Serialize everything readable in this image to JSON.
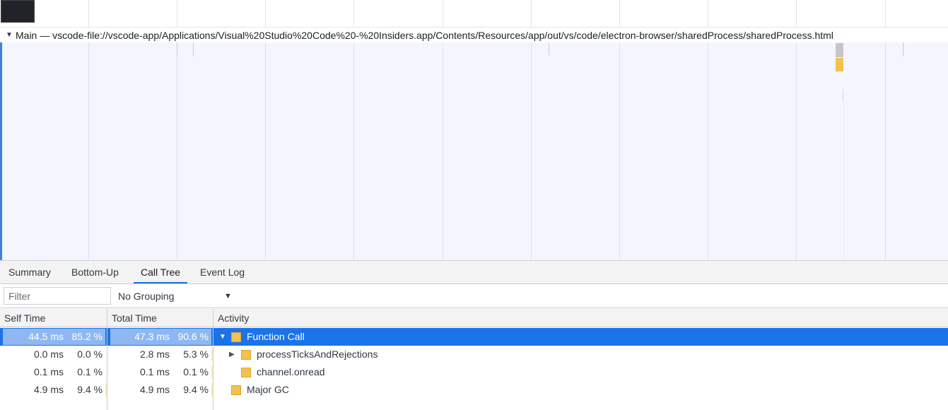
{
  "track": {
    "arrow": "▼",
    "title": "Main — vscode-file://vscode-app/Applications/Visual%20Studio%20Code%20-%20Insiders.app/Contents/Resources/app/out/vs/code/electron-browser/sharedProcess/sharedProcess.html"
  },
  "tabs": [
    {
      "label": "Summary",
      "active": false
    },
    {
      "label": "Bottom-Up",
      "active": false
    },
    {
      "label": "Call Tree",
      "active": true
    },
    {
      "label": "Event Log",
      "active": false
    }
  ],
  "toolbar": {
    "filter_placeholder": "Filter",
    "filter_value": "",
    "grouping": "No Grouping",
    "grouping_arrow": "▼"
  },
  "columns": {
    "self_time": "Self Time",
    "total_time": "Total Time",
    "activity": "Activity"
  },
  "rows": [
    {
      "self_ms": "44.5 ms",
      "self_pct": "85.2 %",
      "self_frac": 0.852,
      "total_ms": "47.3 ms",
      "total_pct": "90.6 %",
      "total_frac": 0.906,
      "disclose": "▼",
      "activity": "Function Call",
      "selected": true
    },
    {
      "self_ms": "0.0 ms",
      "self_pct": "0.0 %",
      "self_frac": 0.0,
      "total_ms": "2.8 ms",
      "total_pct": "5.3 %",
      "total_frac": 0.053,
      "disclose": "▶",
      "activity": "processTicksAndRejections",
      "selected": false
    },
    {
      "self_ms": "0.1 ms",
      "self_pct": "0.1 %",
      "self_frac": 0.001,
      "total_ms": "0.1 ms",
      "total_pct": "0.1 %",
      "total_frac": 0.001,
      "disclose": "",
      "activity": "channel.onread",
      "selected": false
    },
    {
      "self_ms": "4.9 ms",
      "self_pct": "9.4 %",
      "self_frac": 0.094,
      "total_ms": "4.9 ms",
      "total_pct": "9.4 %",
      "total_frac": 0.094,
      "disclose": "",
      "activity": "Major GC",
      "selected": false
    }
  ],
  "colors": {
    "selection": "#1a73e8",
    "scripting": "#f2c14e",
    "bar": "#fbe9b8",
    "accent_border": "#3f80e0"
  }
}
